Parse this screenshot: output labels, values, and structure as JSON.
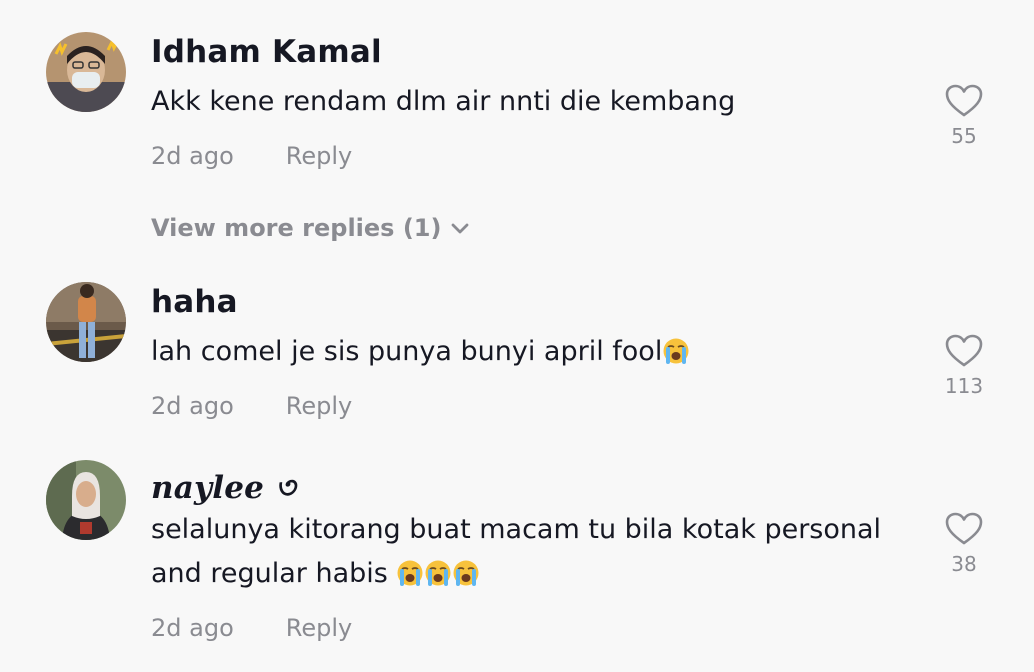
{
  "comments": [
    {
      "username": "Idham Kamal",
      "text": "Akk kene rendam dlm air nnti die kembang",
      "time": "2d ago",
      "reply_label": "Reply",
      "likes": "55"
    },
    {
      "username": "haha",
      "text": "lah comel je sis punya bunyi april fool",
      "time": "2d ago",
      "reply_label": "Reply",
      "likes": "113",
      "emoji": "loudly-crying-face"
    },
    {
      "username": "naylee ৩",
      "text_line1": "selalunya kitorang buat macam tu bila kotak personal",
      "text_line2": "and regular habis",
      "time": "2d ago",
      "reply_label": "Reply",
      "likes": "38",
      "emoji": "loudly-crying-face x3"
    }
  ],
  "view_more_replies": "View more replies (1)",
  "colors": {
    "background": "#f8f8f8",
    "primary_text": "#161823",
    "secondary_text": "#8a8b91"
  }
}
